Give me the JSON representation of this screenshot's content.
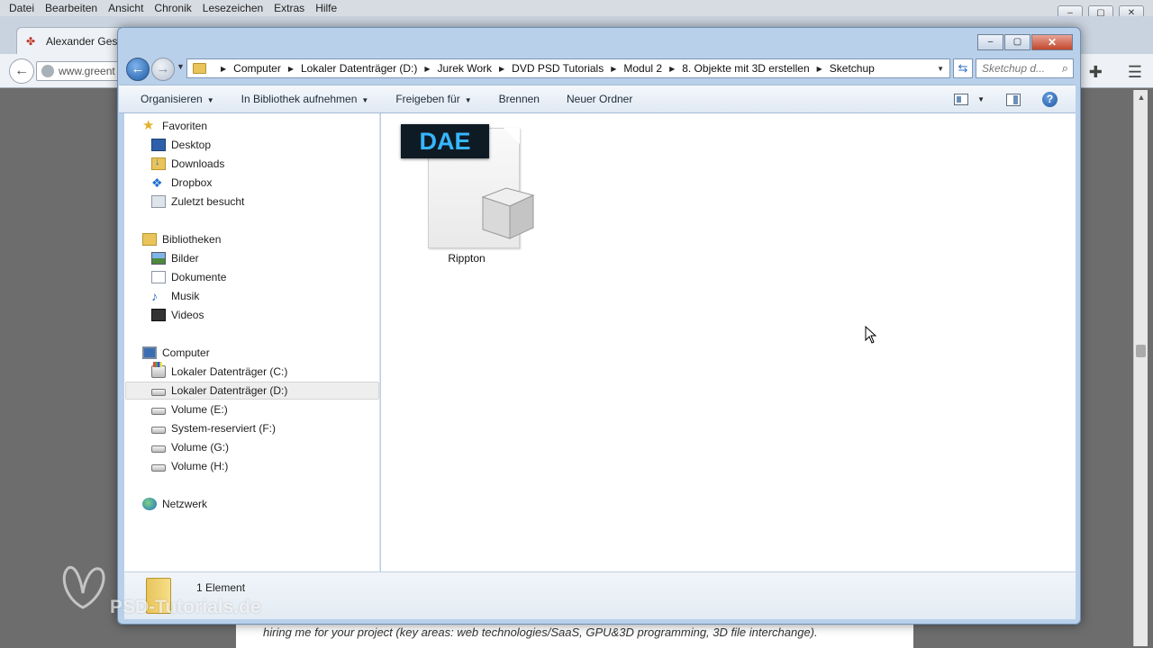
{
  "browser": {
    "menu": [
      "Datei",
      "Bearbeiten",
      "Ansicht",
      "Chronik",
      "Lesezeichen",
      "Extras",
      "Hilfe"
    ],
    "tab_title": "Alexander Gess",
    "url_text": "www.greent",
    "page_caption": "hiring me for your project (key areas: web technologies/SaaS, GPU&3D programming, 3D file interchange)."
  },
  "explorer": {
    "breadcrumbs": [
      "Computer",
      "Lokaler Datenträger (D:)",
      "Jurek Work",
      "DVD PSD Tutorials",
      "Modul 2",
      "8. Objekte mit 3D erstellen",
      "Sketchup"
    ],
    "search_placeholder": "Sketchup d...",
    "toolbar": {
      "organize": "Organisieren",
      "include_library": "In Bibliothek aufnehmen",
      "share": "Freigeben für",
      "burn": "Brennen",
      "new_folder": "Neuer Ordner"
    },
    "nav": {
      "favorites": "Favoriten",
      "desktop": "Desktop",
      "downloads": "Downloads",
      "dropbox": "Dropbox",
      "recent": "Zuletzt besucht",
      "libraries": "Bibliotheken",
      "pictures": "Bilder",
      "documents": "Dokumente",
      "music": "Musik",
      "videos": "Videos",
      "computer": "Computer",
      "drive_c": "Lokaler Datenträger (C:)",
      "drive_d": "Lokaler Datenträger (D:)",
      "drive_e": "Volume (E:)",
      "drive_f": "System-reserviert (F:)",
      "drive_g": "Volume (G:)",
      "drive_h": "Volume (H:)",
      "network": "Netzwerk"
    },
    "files": [
      {
        "name": "Rippton",
        "badge": "DAE"
      }
    ],
    "status": "1 Element"
  },
  "watermark": "PSD-Tutorials.de",
  "colors": {
    "dae_badge_bg": "#0f1b24",
    "dae_badge_text": "#37b6ff",
    "window_frame": "#b8d0ea"
  }
}
